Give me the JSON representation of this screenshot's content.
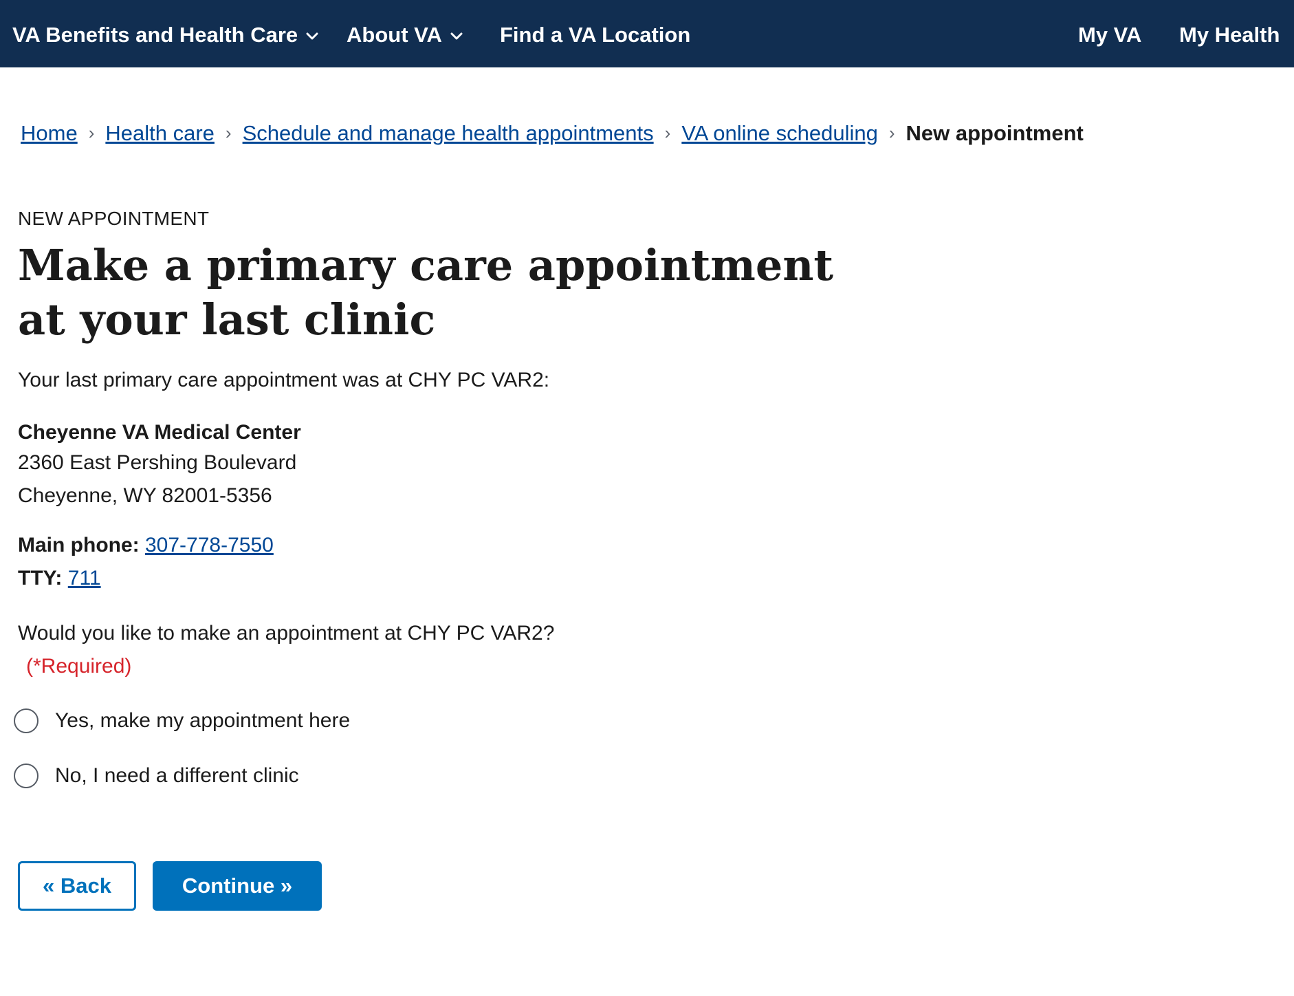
{
  "topnav": {
    "benefits": "VA Benefits and Health Care",
    "about": "About VA",
    "find": "Find a VA Location",
    "myva": "My VA",
    "myhealth": "My Health"
  },
  "breadcrumb": {
    "home": "Home",
    "health_care": "Health care",
    "schedule": "Schedule and manage health appointments",
    "online_scheduling": "VA online scheduling",
    "current": "New appointment"
  },
  "page": {
    "eyebrow": "NEW APPOINTMENT",
    "title": "Make a primary care appointment at your last clinic",
    "intro": "Your last primary care appointment was at CHY PC VAR2:"
  },
  "facility": {
    "name": "Cheyenne VA Medical Center",
    "address_line1": "2360 East Pershing Boulevard",
    "address_line2": "Cheyenne, WY 82001-5356",
    "main_phone_label": "Main phone:",
    "main_phone": "307-778-7550",
    "tty_label": "TTY:",
    "tty": "711"
  },
  "question": {
    "text": "Would you like to make an appointment at CHY PC VAR2?",
    "required": "(*Required)",
    "options": [
      "Yes, make my appointment here",
      "No, I need a different clinic"
    ]
  },
  "buttons": {
    "back": "« Back",
    "continue": "Continue »"
  },
  "colors": {
    "nav_bg": "#112e51",
    "link": "#004795",
    "primary": "#0071bb",
    "required": "#d6242b"
  }
}
